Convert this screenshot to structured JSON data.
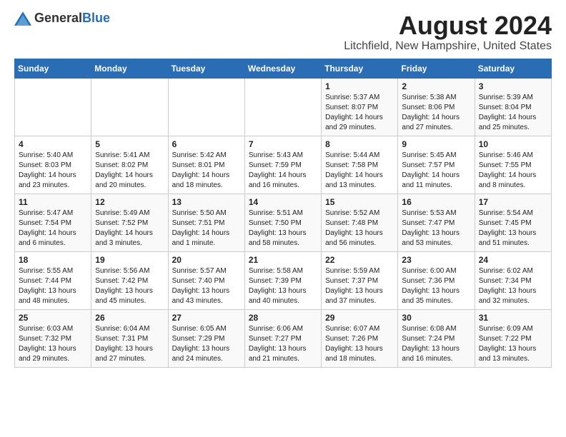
{
  "logo": {
    "text_general": "General",
    "text_blue": "Blue"
  },
  "title": "August 2024",
  "subtitle": "Litchfield, New Hampshire, United States",
  "header_days": [
    "Sunday",
    "Monday",
    "Tuesday",
    "Wednesday",
    "Thursday",
    "Friday",
    "Saturday"
  ],
  "weeks": [
    [
      {
        "day": "",
        "info": ""
      },
      {
        "day": "",
        "info": ""
      },
      {
        "day": "",
        "info": ""
      },
      {
        "day": "",
        "info": ""
      },
      {
        "day": "1",
        "info": "Sunrise: 5:37 AM\nSunset: 8:07 PM\nDaylight: 14 hours\nand 29 minutes."
      },
      {
        "day": "2",
        "info": "Sunrise: 5:38 AM\nSunset: 8:06 PM\nDaylight: 14 hours\nand 27 minutes."
      },
      {
        "day": "3",
        "info": "Sunrise: 5:39 AM\nSunset: 8:04 PM\nDaylight: 14 hours\nand 25 minutes."
      }
    ],
    [
      {
        "day": "4",
        "info": "Sunrise: 5:40 AM\nSunset: 8:03 PM\nDaylight: 14 hours\nand 23 minutes."
      },
      {
        "day": "5",
        "info": "Sunrise: 5:41 AM\nSunset: 8:02 PM\nDaylight: 14 hours\nand 20 minutes."
      },
      {
        "day": "6",
        "info": "Sunrise: 5:42 AM\nSunset: 8:01 PM\nDaylight: 14 hours\nand 18 minutes."
      },
      {
        "day": "7",
        "info": "Sunrise: 5:43 AM\nSunset: 7:59 PM\nDaylight: 14 hours\nand 16 minutes."
      },
      {
        "day": "8",
        "info": "Sunrise: 5:44 AM\nSunset: 7:58 PM\nDaylight: 14 hours\nand 13 minutes."
      },
      {
        "day": "9",
        "info": "Sunrise: 5:45 AM\nSunset: 7:57 PM\nDaylight: 14 hours\nand 11 minutes."
      },
      {
        "day": "10",
        "info": "Sunrise: 5:46 AM\nSunset: 7:55 PM\nDaylight: 14 hours\nand 8 minutes."
      }
    ],
    [
      {
        "day": "11",
        "info": "Sunrise: 5:47 AM\nSunset: 7:54 PM\nDaylight: 14 hours\nand 6 minutes."
      },
      {
        "day": "12",
        "info": "Sunrise: 5:49 AM\nSunset: 7:52 PM\nDaylight: 14 hours\nand 3 minutes."
      },
      {
        "day": "13",
        "info": "Sunrise: 5:50 AM\nSunset: 7:51 PM\nDaylight: 14 hours\nand 1 minute."
      },
      {
        "day": "14",
        "info": "Sunrise: 5:51 AM\nSunset: 7:50 PM\nDaylight: 13 hours\nand 58 minutes."
      },
      {
        "day": "15",
        "info": "Sunrise: 5:52 AM\nSunset: 7:48 PM\nDaylight: 13 hours\nand 56 minutes."
      },
      {
        "day": "16",
        "info": "Sunrise: 5:53 AM\nSunset: 7:47 PM\nDaylight: 13 hours\nand 53 minutes."
      },
      {
        "day": "17",
        "info": "Sunrise: 5:54 AM\nSunset: 7:45 PM\nDaylight: 13 hours\nand 51 minutes."
      }
    ],
    [
      {
        "day": "18",
        "info": "Sunrise: 5:55 AM\nSunset: 7:44 PM\nDaylight: 13 hours\nand 48 minutes."
      },
      {
        "day": "19",
        "info": "Sunrise: 5:56 AM\nSunset: 7:42 PM\nDaylight: 13 hours\nand 45 minutes."
      },
      {
        "day": "20",
        "info": "Sunrise: 5:57 AM\nSunset: 7:40 PM\nDaylight: 13 hours\nand 43 minutes."
      },
      {
        "day": "21",
        "info": "Sunrise: 5:58 AM\nSunset: 7:39 PM\nDaylight: 13 hours\nand 40 minutes."
      },
      {
        "day": "22",
        "info": "Sunrise: 5:59 AM\nSunset: 7:37 PM\nDaylight: 13 hours\nand 37 minutes."
      },
      {
        "day": "23",
        "info": "Sunrise: 6:00 AM\nSunset: 7:36 PM\nDaylight: 13 hours\nand 35 minutes."
      },
      {
        "day": "24",
        "info": "Sunrise: 6:02 AM\nSunset: 7:34 PM\nDaylight: 13 hours\nand 32 minutes."
      }
    ],
    [
      {
        "day": "25",
        "info": "Sunrise: 6:03 AM\nSunset: 7:32 PM\nDaylight: 13 hours\nand 29 minutes."
      },
      {
        "day": "26",
        "info": "Sunrise: 6:04 AM\nSunset: 7:31 PM\nDaylight: 13 hours\nand 27 minutes."
      },
      {
        "day": "27",
        "info": "Sunrise: 6:05 AM\nSunset: 7:29 PM\nDaylight: 13 hours\nand 24 minutes."
      },
      {
        "day": "28",
        "info": "Sunrise: 6:06 AM\nSunset: 7:27 PM\nDaylight: 13 hours\nand 21 minutes."
      },
      {
        "day": "29",
        "info": "Sunrise: 6:07 AM\nSunset: 7:26 PM\nDaylight: 13 hours\nand 18 minutes."
      },
      {
        "day": "30",
        "info": "Sunrise: 6:08 AM\nSunset: 7:24 PM\nDaylight: 13 hours\nand 16 minutes."
      },
      {
        "day": "31",
        "info": "Sunrise: 6:09 AM\nSunset: 7:22 PM\nDaylight: 13 hours\nand 13 minutes."
      }
    ]
  ]
}
